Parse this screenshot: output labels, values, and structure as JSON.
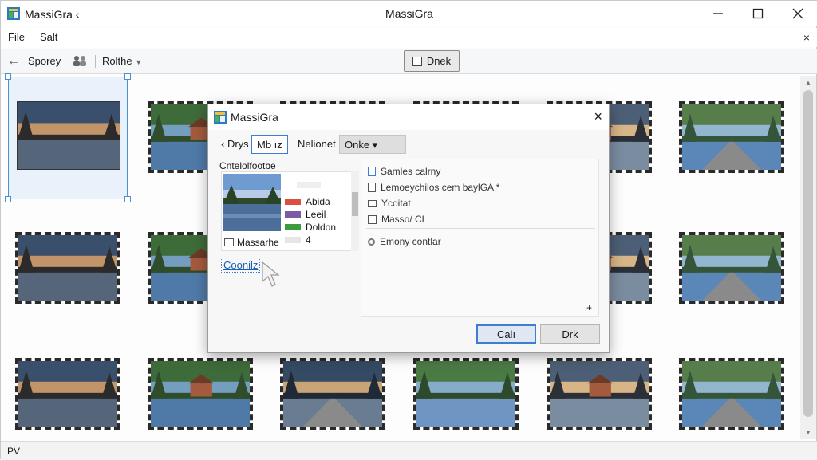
{
  "window": {
    "app_name": "MassiGra ‹",
    "title": "MassiGra"
  },
  "menu": {
    "file": "File",
    "edit": "Salt",
    "close_glyph": "×"
  },
  "toolbar": {
    "back_label": "Sporey",
    "route_label": "Rolthe",
    "check_label": "Dnek"
  },
  "dialog": {
    "title": "MassiGra",
    "close_glyph": "×",
    "tabs": [
      "‹ Drys",
      "Mb ız",
      "Nelionet",
      "Onke ▾"
    ],
    "left_label": "Cntelolfootbe",
    "legend": [
      {
        "label": "Abida",
        "color": "#d95040"
      },
      {
        "label": "Leeil",
        "color": "#7b5aa6"
      },
      {
        "label": "Doldon",
        "color": "#3d9a3d"
      },
      {
        "label": "4",
        "color": "#e6e6e6"
      }
    ],
    "file_label": "Massarhe",
    "link_label": "Coonilz",
    "right_items": [
      {
        "icon": "doc-icon",
        "label": "Samles calrny"
      },
      {
        "icon": "copy-icon",
        "label": "Lemoeychilos cem baylGA *"
      },
      {
        "icon": "window-icon",
        "label": "Ycoitat"
      },
      {
        "icon": "picture-icon",
        "label": "Masso/ CL"
      }
    ],
    "extra_item": "Emony contlar",
    "plus_glyph": "+",
    "ok_label": "Calı",
    "cancel_label": "Drk"
  },
  "status": {
    "text": "PV"
  },
  "colors": {
    "accent": "#3c7fd0",
    "selection": "#e9f1fb"
  }
}
